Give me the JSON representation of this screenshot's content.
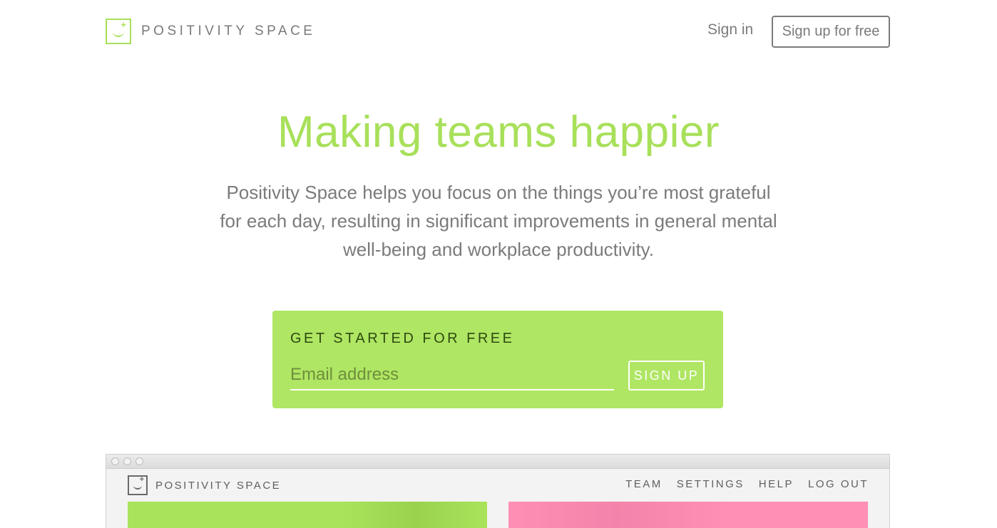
{
  "header": {
    "brand": "POSITIVITY SPACE",
    "sign_in": "Sign in",
    "sign_up": "Sign up for free"
  },
  "hero": {
    "title": "Making teams happier",
    "subtitle": "Positivity Space helps you focus on the things you’re most grateful for each day, resulting in significant improvements in general mental well-being and workplace productivity."
  },
  "cta": {
    "heading": "GET STARTED FOR FREE",
    "email_placeholder": "Email address",
    "email_value": "",
    "button": "SIGN UP"
  },
  "preview": {
    "brand": "POSITIVITY SPACE",
    "menu": [
      "TEAM",
      "SETTINGS",
      "HELP",
      "LOG OUT"
    ]
  },
  "colors": {
    "accent_green": "#a8e05a",
    "cta_green": "#afe663",
    "pink": "#ff8fb4",
    "text_gray": "#7b7b7b"
  }
}
